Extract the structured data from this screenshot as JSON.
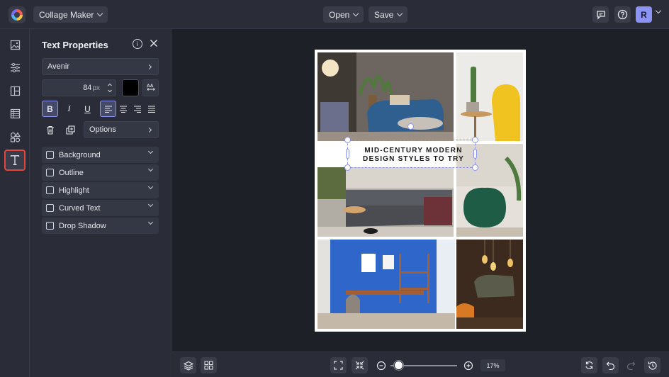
{
  "header": {
    "app_switcher_label": "Collage Maker",
    "open_label": "Open",
    "save_label": "Save",
    "avatar_initial": "R"
  },
  "rail": {
    "items": [
      "image-icon",
      "adjustments-icon",
      "layout-icon",
      "texture-icon",
      "graphics-icon",
      "text-icon"
    ],
    "active": "text-icon"
  },
  "panel": {
    "title": "Text Properties",
    "font_name": "Avenir",
    "font_size": "84",
    "font_size_unit": "px",
    "text_color": "#000000",
    "format": {
      "bold": true,
      "italic": false,
      "underline": false,
      "align": "left"
    },
    "options_label": "Options",
    "effects": [
      {
        "label": "Background",
        "checked": false
      },
      {
        "label": "Outline",
        "checked": false
      },
      {
        "label": "Highlight",
        "checked": false
      },
      {
        "label": "Curved Text",
        "checked": false
      },
      {
        "label": "Drop Shadow",
        "checked": false
      }
    ]
  },
  "canvas": {
    "caption_line1": "MID-CENTURY MODERN",
    "caption_line2": "DESIGN STYLES TO TRY"
  },
  "bottom": {
    "zoom_percent": "17%",
    "zoom_fraction": 0.17
  },
  "colors": {
    "accent": "#8b93f5",
    "highlight_border": "#e2453b"
  }
}
